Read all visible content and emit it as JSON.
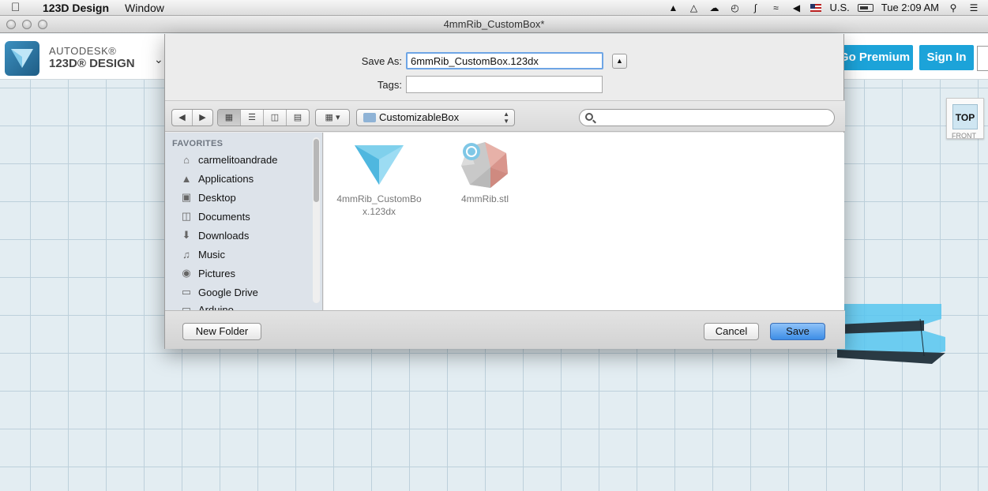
{
  "menubar": {
    "app_name": "123D Design",
    "menu_window": "Window",
    "keyboard": "U.S.",
    "clock": "Tue 2:09 AM"
  },
  "window": {
    "title": "4mmRib_CustomBox*"
  },
  "app": {
    "brand_line1": "AUTODESK®",
    "brand_line2": "123D® DESIGN",
    "go_premium": "Go Premium",
    "sign_in": "Sign In",
    "accent": "#1ca3d9"
  },
  "viewcube": {
    "face": "TOP",
    "back": "FRONT"
  },
  "dialog": {
    "save_as_label": "Save As:",
    "save_as_value": "6mmRib_CustomBox.123dx",
    "tags_label": "Tags:",
    "tags_value": "",
    "current_folder": "CustomizableBox",
    "search_placeholder": "",
    "sidebar_header": "FAVORITES",
    "favorites": [
      {
        "label": "carmelitoandrade",
        "icon": "home-icon"
      },
      {
        "label": "Applications",
        "icon": "applications-icon"
      },
      {
        "label": "Desktop",
        "icon": "desktop-icon"
      },
      {
        "label": "Documents",
        "icon": "documents-icon"
      },
      {
        "label": "Downloads",
        "icon": "downloads-icon"
      },
      {
        "label": "Music",
        "icon": "music-icon"
      },
      {
        "label": "Pictures",
        "icon": "pictures-icon"
      },
      {
        "label": "Google Drive",
        "icon": "folder-icon"
      },
      {
        "label": "Arduino",
        "icon": "folder-icon"
      }
    ],
    "files": [
      {
        "line1": "4mmRib_CustomBo",
        "line2": "x.123dx"
      },
      {
        "line1": "4mmRib.stl",
        "line2": ""
      }
    ],
    "new_folder": "New Folder",
    "cancel": "Cancel",
    "save": "Save"
  }
}
